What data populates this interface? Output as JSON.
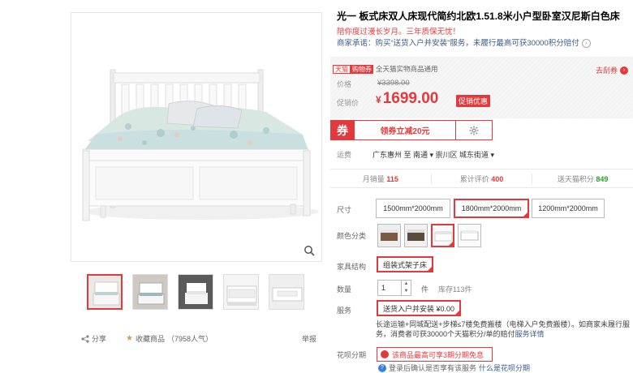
{
  "product": {
    "title": "光一 板式床双人床现代简约北欧1.51.8米小户型卧室汉尼斯白色床",
    "promo_text": "陪你度过漫长岁月。三年质保无忧！",
    "merchant_promise": "商家承诺：购买“送货入户并安装”服务，未履行最高可获30000积分赔付"
  },
  "price_box": {
    "tmall_tag": "天猫",
    "coupon_tag": "购物券",
    "tmall_note": "全天猫实物商品通用",
    "go_cart_label": "去刮券",
    "orig_label": "价格",
    "orig_price": "¥3398.00",
    "promo_label": "促销价",
    "promo_currency": "¥",
    "promo_price": "1699.00",
    "promo_badge": "促销优惠"
  },
  "coupon": {
    "icon_label": "券",
    "label": "领券立减20元"
  },
  "shipping": {
    "label": "运费",
    "value": "广东惠州 至 南通 ▾ 崇川区 城东街道 ▾"
  },
  "stats": [
    {
      "label": "月销量",
      "value": "115",
      "color": "red"
    },
    {
      "label": "累计评价",
      "value": "400",
      "color": "red"
    },
    {
      "label": "送天猫积分",
      "value": "849",
      "color": "green"
    }
  ],
  "options": {
    "size_label": "尺寸",
    "sizes": [
      "1500mm*2000mm",
      "1800mm*2000mm",
      "1200mm*2000mm"
    ],
    "selected_size_index": 1,
    "color_label": "颜色分类",
    "selected_color_index": 2,
    "structure_label": "家具结构",
    "structure_value": "组装式架子床",
    "qty_label": "数量",
    "qty_value": "1",
    "qty_unit": "件",
    "stock": "库存113件",
    "service_label": "服务",
    "service_value": "送货入户并安装 ¥0.00",
    "service_desc": "长途运输+同城配送+步梯≤7楼免费搬楼（电梯入户免费搬楼）。如商家未履行服务，消费者可获30000个天猫积分/单的赔付",
    "service_link": "服务详情"
  },
  "huabei": {
    "label": "花呗分期",
    "button": "该商品最高可享3期分期免息",
    "note": "登录后确认是否享有该服务",
    "note_link": "什么是花呗分期"
  },
  "gallery": {
    "share_label": "分享",
    "fav_label": "收藏商品",
    "fav_count": "（7958人气）",
    "report_label": "举报"
  },
  "colors": {
    "accent": "#e4393c",
    "link": "#3c5c8c",
    "green": "#2a9d2a"
  }
}
